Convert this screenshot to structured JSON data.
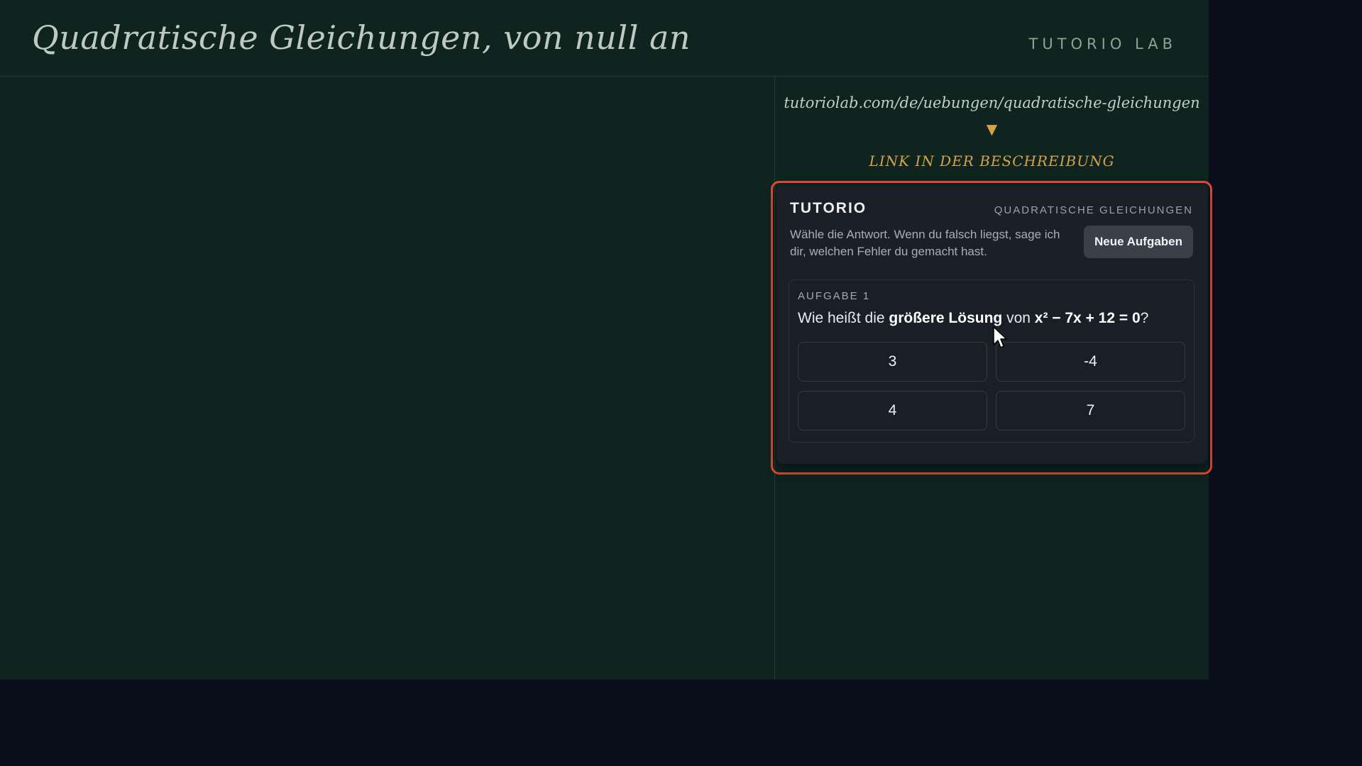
{
  "header": {
    "title": "Quadratische Gleichungen, von null an",
    "brand": "TUTORIO LAB"
  },
  "side": {
    "url": "tutoriolab.com/de/uebungen/quadratische-gleichungen",
    "arrow": "▼",
    "cta": "LINK IN DER BESCHREIBUNG"
  },
  "card": {
    "brand": "TUTORIO",
    "topic": "QUADRATISCHE GLEICHUNGEN",
    "description": "Wähle die Antwort. Wenn du falsch liegst, sage ich dir, welchen Fehler du gemacht hast.",
    "new_tasks_label": "Neue Aufgaben",
    "task": {
      "label": "AUFGABE 1",
      "question_prefix": "Wie heißt die ",
      "question_emphasis": "größere Lösung",
      "question_mid": " von ",
      "question_equation": "x² − 7x + 12 = 0",
      "question_suffix": "?",
      "options": [
        "3",
        "-4",
        "4",
        "7"
      ]
    }
  },
  "colors": {
    "stage_bg": "#0f241f",
    "page_bg": "#0b0f1b",
    "card_bg": "#1b1f28",
    "accent_gold": "#d4a24a",
    "highlight_red": "#e04a3a"
  }
}
